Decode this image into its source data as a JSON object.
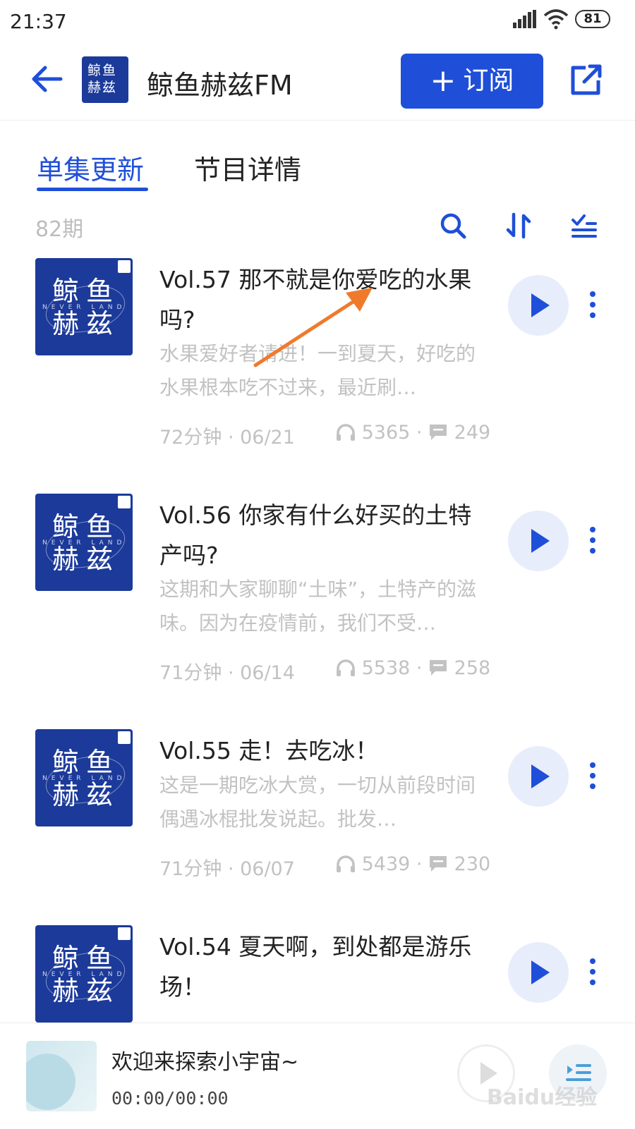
{
  "status_bar": {
    "time": "21:37",
    "battery": "81"
  },
  "header": {
    "title": "鲸鱼赫兹FM",
    "logo_text": "鲸鱼\n赫兹",
    "subscribe_label": "订阅"
  },
  "tabs": [
    {
      "label": "单集更新",
      "active": true
    },
    {
      "label": "节目详情",
      "active": false
    }
  ],
  "toolbar": {
    "count": "82期"
  },
  "cover_text": {
    "line1": "鲸鱼",
    "line2": "赫兹",
    "tag": "NEVER LAND"
  },
  "episodes": [
    {
      "title": "Vol.57 那不就是你爱吃的水果吗?",
      "desc": "水果爱好者请进！一到夏天，好吃的水果根本吃不过来，最近刷…",
      "duration_date": "72分钟 · 06/21",
      "plays": "5365",
      "comments": "249"
    },
    {
      "title": "Vol.56 你家有什么好买的土特产吗?",
      "desc": "这期和大家聊聊“土味”，土特产的滋味。因为在疫情前，我们不受…",
      "duration_date": "71分钟 · 06/14",
      "plays": "5538",
      "comments": "258"
    },
    {
      "title": "Vol.55 走！去吃冰！",
      "desc": "这是一期吃冰大赏，一切从前段时间偶遇冰棍批发说起。批发…",
      "duration_date": "71分钟 · 06/07",
      "plays": "5439",
      "comments": "230"
    },
    {
      "title": "Vol.54 夏天啊，到处都是游乐场！"
    }
  ],
  "player": {
    "title": "欢迎来探索小宇宙~",
    "time": "00:00/00:00"
  },
  "watermark": "Baidu经验",
  "colors": {
    "accent": "#1f4fd8",
    "cover": "#1c3a9a",
    "annotation_arrow": "#f07a2c"
  }
}
